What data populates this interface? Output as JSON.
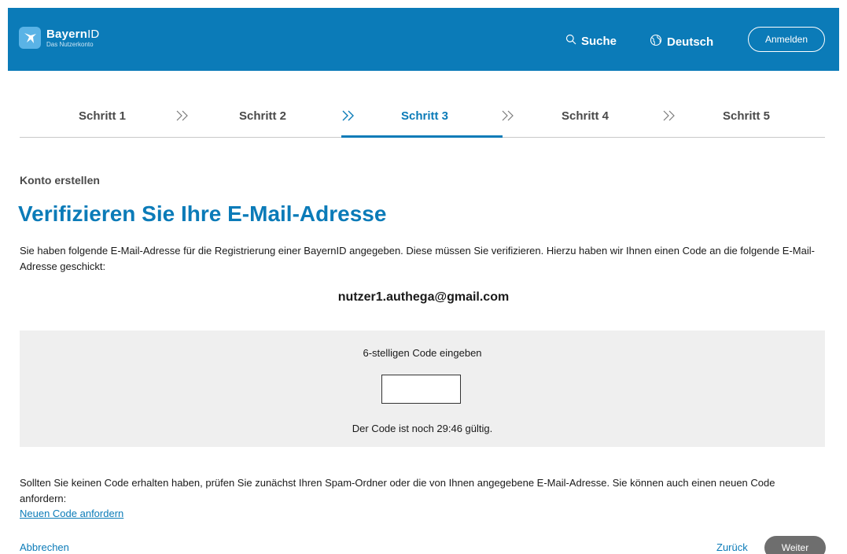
{
  "header": {
    "brand_bold": "Bayern",
    "brand_light": "ID",
    "brand_sub": "Das Nutzerkonto",
    "search_label": "Suche",
    "language_label": "Deutsch",
    "login_label": "Anmelden",
    "background_color": "#0b7bb8"
  },
  "steps": {
    "items": [
      {
        "label": "Schritt 1",
        "active": false
      },
      {
        "label": "Schritt 2",
        "active": false
      },
      {
        "label": "Schritt 3",
        "active": true
      },
      {
        "label": "Schritt 4",
        "active": false
      },
      {
        "label": "Schritt 5",
        "active": false
      }
    ],
    "separator_icon": "double-chevron-right-icon",
    "active_color": "#0b7bb8"
  },
  "main": {
    "overline": "Konto erstellen",
    "title": "Verifizieren Sie Ihre E-Mail-Adresse",
    "intro": "Sie haben folgende E-Mail-Adresse für die Registrierung einer BayernID angegeben. Diese müssen Sie verifizieren. Hierzu haben wir Ihnen einen Code an die folgende E-Mail-Adresse geschickt:",
    "email": "nutzer1.authega@gmail.com"
  },
  "code": {
    "label": "6-stelligen Code eingeben",
    "value": "",
    "validity": "Der Code ist noch 29:46 gültig."
  },
  "footer": {
    "spam_note": "Sollten Sie keinen Code erhalten haben, prüfen Sie zunächst Ihren Spam-Ordner oder die von Ihnen angegebene E-Mail-Adresse. Sie können auch einen neuen Code anfordern:",
    "new_code_link": "Neuen Code anfordern",
    "cancel_link": "Abbrechen",
    "back_link": "Zurück",
    "next_button": "Weiter"
  }
}
